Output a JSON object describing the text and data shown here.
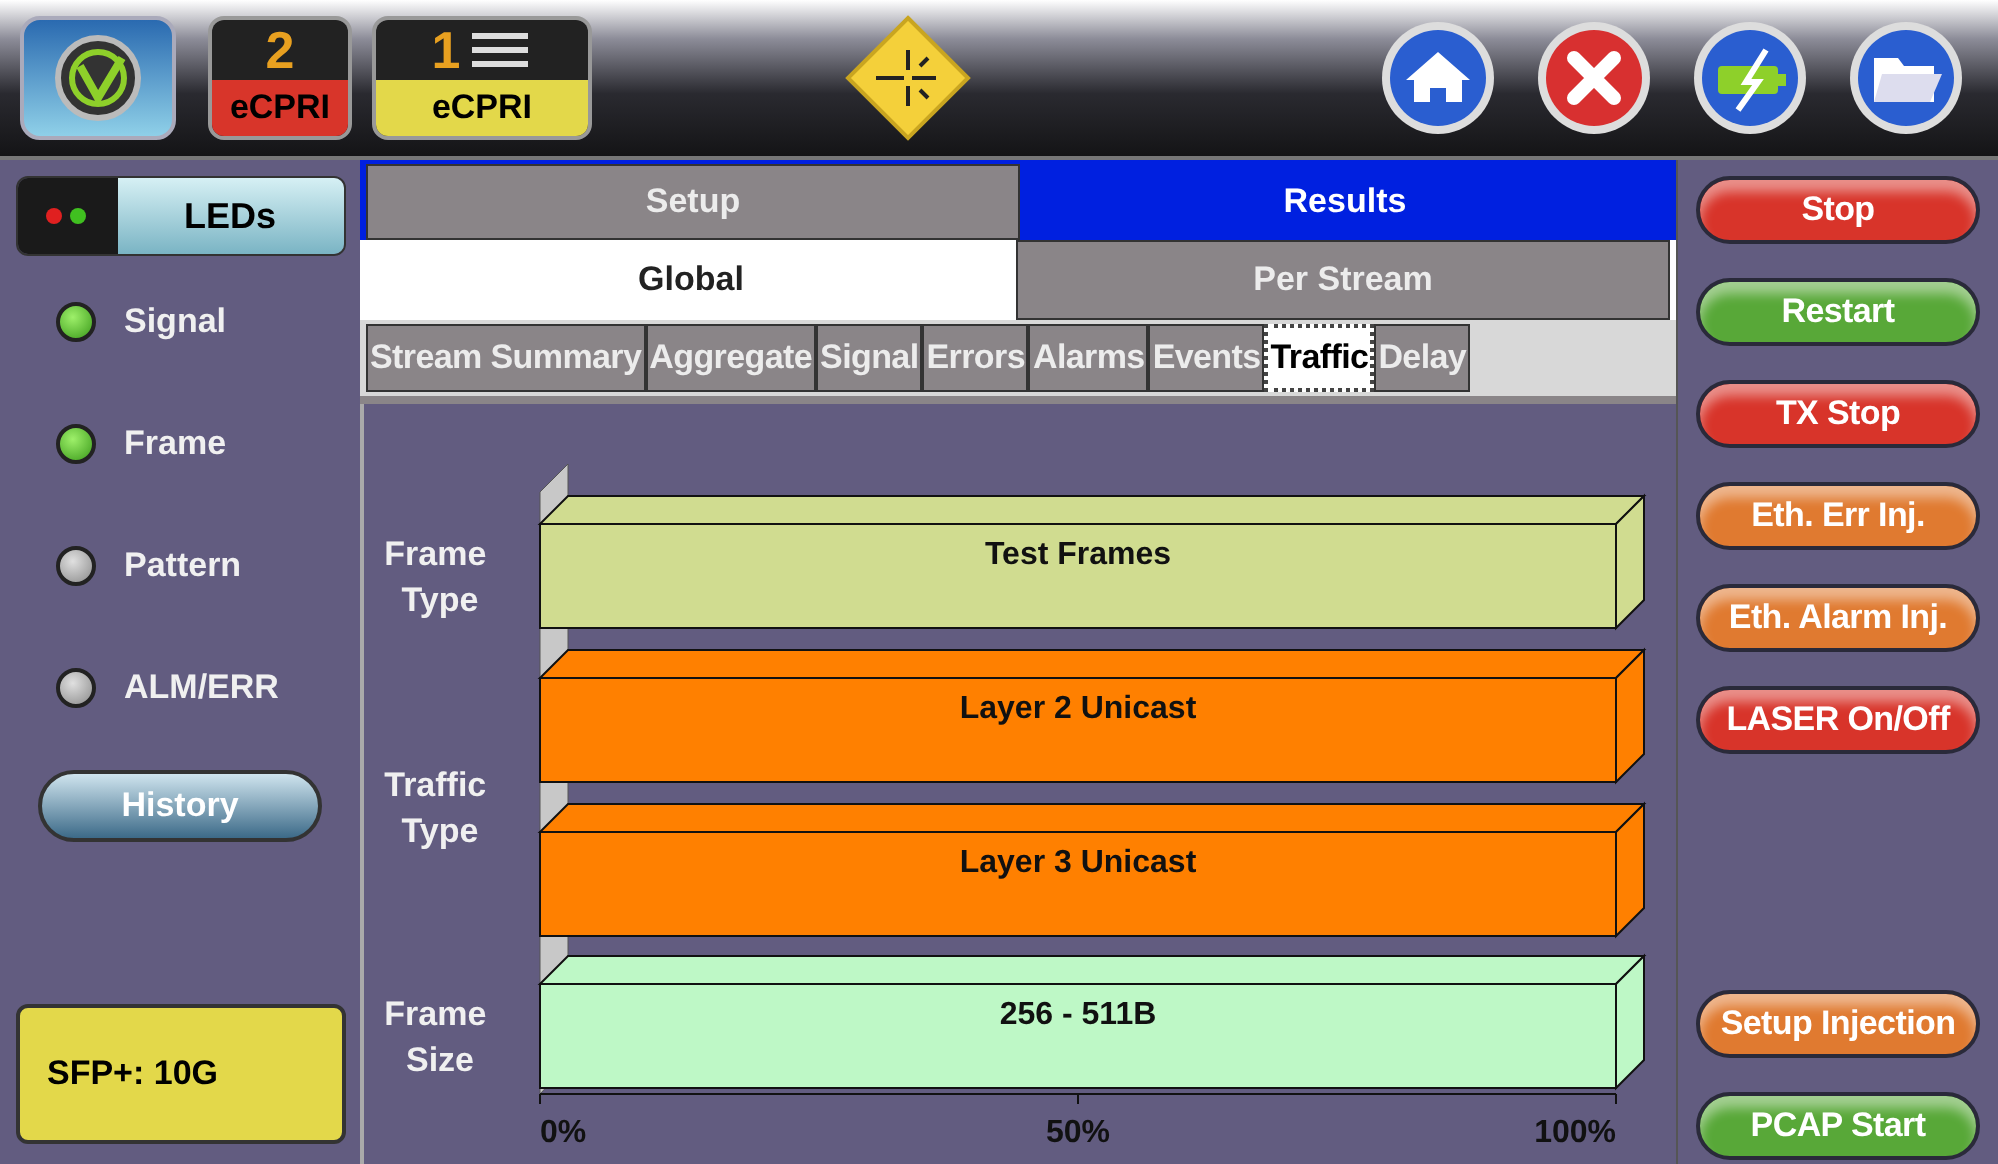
{
  "top_bar": {
    "port_badges": [
      {
        "number": "2",
        "label": "eCPRI",
        "color": "#d8352a"
      },
      {
        "number": "1",
        "label": "eCPRI",
        "color": "#e3d84a"
      }
    ]
  },
  "left_panel": {
    "leds_button": "LEDs",
    "leds": [
      {
        "label": "Signal",
        "on": true
      },
      {
        "label": "Frame",
        "on": true
      },
      {
        "label": "Pattern",
        "on": false
      },
      {
        "label": "ALM/ERR",
        "on": false
      }
    ],
    "history_button": "History",
    "sfp_label": "SFP+: 10G"
  },
  "main_tabs": [
    {
      "label": "Setup",
      "selected": false
    },
    {
      "label": "Results",
      "selected": true
    }
  ],
  "scope_tabs": [
    {
      "label": "Global",
      "selected": true
    },
    {
      "label": "Per Stream",
      "selected": false
    }
  ],
  "result_tabs": [
    {
      "label": "Stream Summary",
      "selected": false
    },
    {
      "label": "Aggregate",
      "selected": false
    },
    {
      "label": "Signal",
      "selected": false
    },
    {
      "label": "Errors",
      "selected": false
    },
    {
      "label": "Alarms",
      "selected": false
    },
    {
      "label": "Events",
      "selected": false
    },
    {
      "label": "Traffic",
      "selected": true
    },
    {
      "label": "Delay",
      "selected": false
    }
  ],
  "traffic_chart": {
    "groups": [
      {
        "label": "Frame Type",
        "bars": [
          {
            "text": "Test Frames",
            "color": "#d0dc90",
            "level": 1
          }
        ]
      },
      {
        "label": "Traffic Type",
        "bars": [
          {
            "text": "Layer 2 Unicast",
            "color": "#ff8000",
            "level": 1
          },
          {
            "text": "Layer 3 Unicast",
            "color": "#ff8000",
            "level": 1
          }
        ]
      },
      {
        "label": "Frame Size",
        "bars": [
          {
            "text": "256 - 511B",
            "color": "#bef8c6",
            "level": 1
          }
        ]
      }
    ],
    "axis_ticks": [
      "0%",
      "50%",
      "100%"
    ]
  },
  "right_buttons": [
    {
      "label": "Stop",
      "color": "#d8342a"
    },
    {
      "label": "Restart",
      "color": "#58a838"
    },
    {
      "label": "TX Stop",
      "color": "#d8342a"
    },
    {
      "label": "Eth. Err Inj.",
      "color": "#e07a30"
    },
    {
      "label": "Eth. Alarm Inj.",
      "color": "#e07a30"
    },
    {
      "label": "LASER On/Off",
      "color": "#d8342a"
    }
  ],
  "bottom_right_buttons": [
    {
      "label": "Setup Injection",
      "color": "#e07a30"
    },
    {
      "label": "PCAP Start",
      "color": "#58a838"
    }
  ]
}
